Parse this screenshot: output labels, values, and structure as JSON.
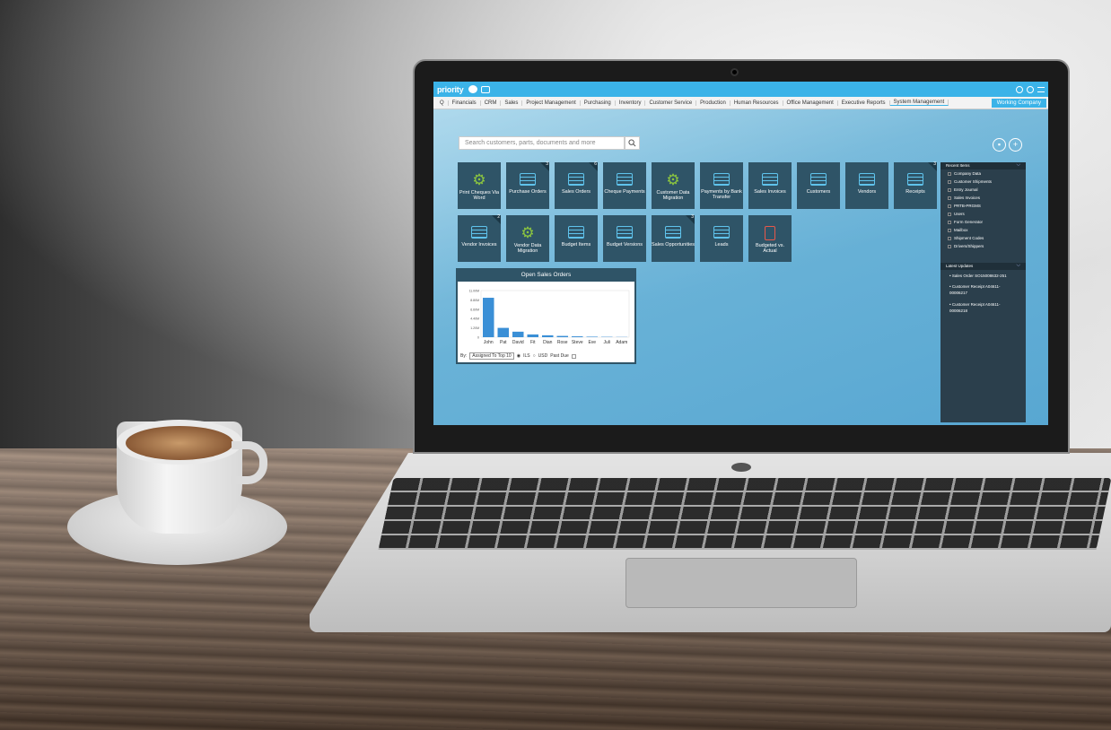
{
  "app": {
    "logo": "priority",
    "working_company": "Working Company"
  },
  "menu": [
    "Financials",
    "CRM",
    "Sales",
    "Project Management",
    "Purchasing",
    "Inventory",
    "Customer Service",
    "Production",
    "Human Resources",
    "Office Management",
    "Executive Reports",
    "System Management"
  ],
  "search": {
    "placeholder": "Search customers, parts, documents and more"
  },
  "tiles_row1": [
    {
      "label": "Print Cheques Via Word",
      "icon": "gear-icon",
      "badge": ""
    },
    {
      "label": "Purchase Orders",
      "icon": "form-icon",
      "badge": "3"
    },
    {
      "label": "Sales Orders",
      "icon": "form-icon",
      "badge": "6"
    },
    {
      "label": "Cheque Payments",
      "icon": "form-icon",
      "badge": ""
    },
    {
      "label": "Customer Data Migration",
      "icon": "gear-icon",
      "badge": ""
    },
    {
      "label": "Payments by Bank Transfer",
      "icon": "form-icon",
      "badge": ""
    },
    {
      "label": "Sales Invoices",
      "icon": "form-icon",
      "badge": ""
    },
    {
      "label": "Customers",
      "icon": "form-icon",
      "badge": ""
    },
    {
      "label": "Vendors",
      "icon": "form-icon",
      "badge": ""
    },
    {
      "label": "Receipts",
      "icon": "form-icon",
      "badge": "3"
    }
  ],
  "tiles_row2": [
    {
      "label": "Vendor Invoices",
      "icon": "form-icon",
      "badge": "2"
    },
    {
      "label": "Vendor Data Migration",
      "icon": "gear-icon",
      "badge": ""
    },
    {
      "label": "Budget Items",
      "icon": "form-icon",
      "badge": ""
    },
    {
      "label": "Budget Versions",
      "icon": "form-icon",
      "badge": ""
    },
    {
      "label": "Sales Opportunities",
      "icon": "form-icon",
      "badge": "3"
    },
    {
      "label": "Leads",
      "icon": "form-icon",
      "badge": ""
    },
    {
      "label": "Budgeted vs. Actual",
      "icon": "clipboard-icon",
      "badge": ""
    }
  ],
  "chart_card": {
    "title": "Open Sales Orders",
    "by_label": "By:",
    "select_value": "Assigned To Top 10",
    "radio1": "ILS",
    "radio2": "USD",
    "checkbox": "Past Due"
  },
  "chart_data": {
    "type": "bar",
    "title": "Open Sales Orders",
    "categories": [
      "John",
      "Pat",
      "David",
      "Fit",
      "Dian",
      "Rose",
      "Steve",
      "Eve",
      "Juli",
      "Adam"
    ],
    "values": [
      9.3,
      2.2,
      1.3,
      0.65,
      0.45,
      0.3,
      0.2,
      0.12,
      0.08,
      0.05
    ],
    "y_ticks": [
      "0",
      "1.20M",
      "4.40M",
      "6.60M",
      "8.80M",
      "11.00M"
    ],
    "ylim": [
      0,
      11
    ],
    "bar_color": "#3a8fd6"
  },
  "recent_items": {
    "header": "Recent Items",
    "items": [
      "Company Data",
      "Customer Shipments",
      "Entry Journal",
      "Sales Invoices",
      "PRTB-PRGMS",
      "Users",
      "Form Generator",
      "Mailbox",
      "Shipment Codes",
      "Drivers/Shippers"
    ]
  },
  "latest_updates": {
    "header": "Latest Updates",
    "items": [
      "Sales Order SO15008632-251",
      "Customer Receipt A04611-00006217",
      "Customer Receipt A04611-00006218"
    ]
  },
  "colors": {
    "accent": "#3bb3e8",
    "tile": "#2f5467",
    "panel": "#2b3f4c",
    "gear": "#8cc63f"
  }
}
